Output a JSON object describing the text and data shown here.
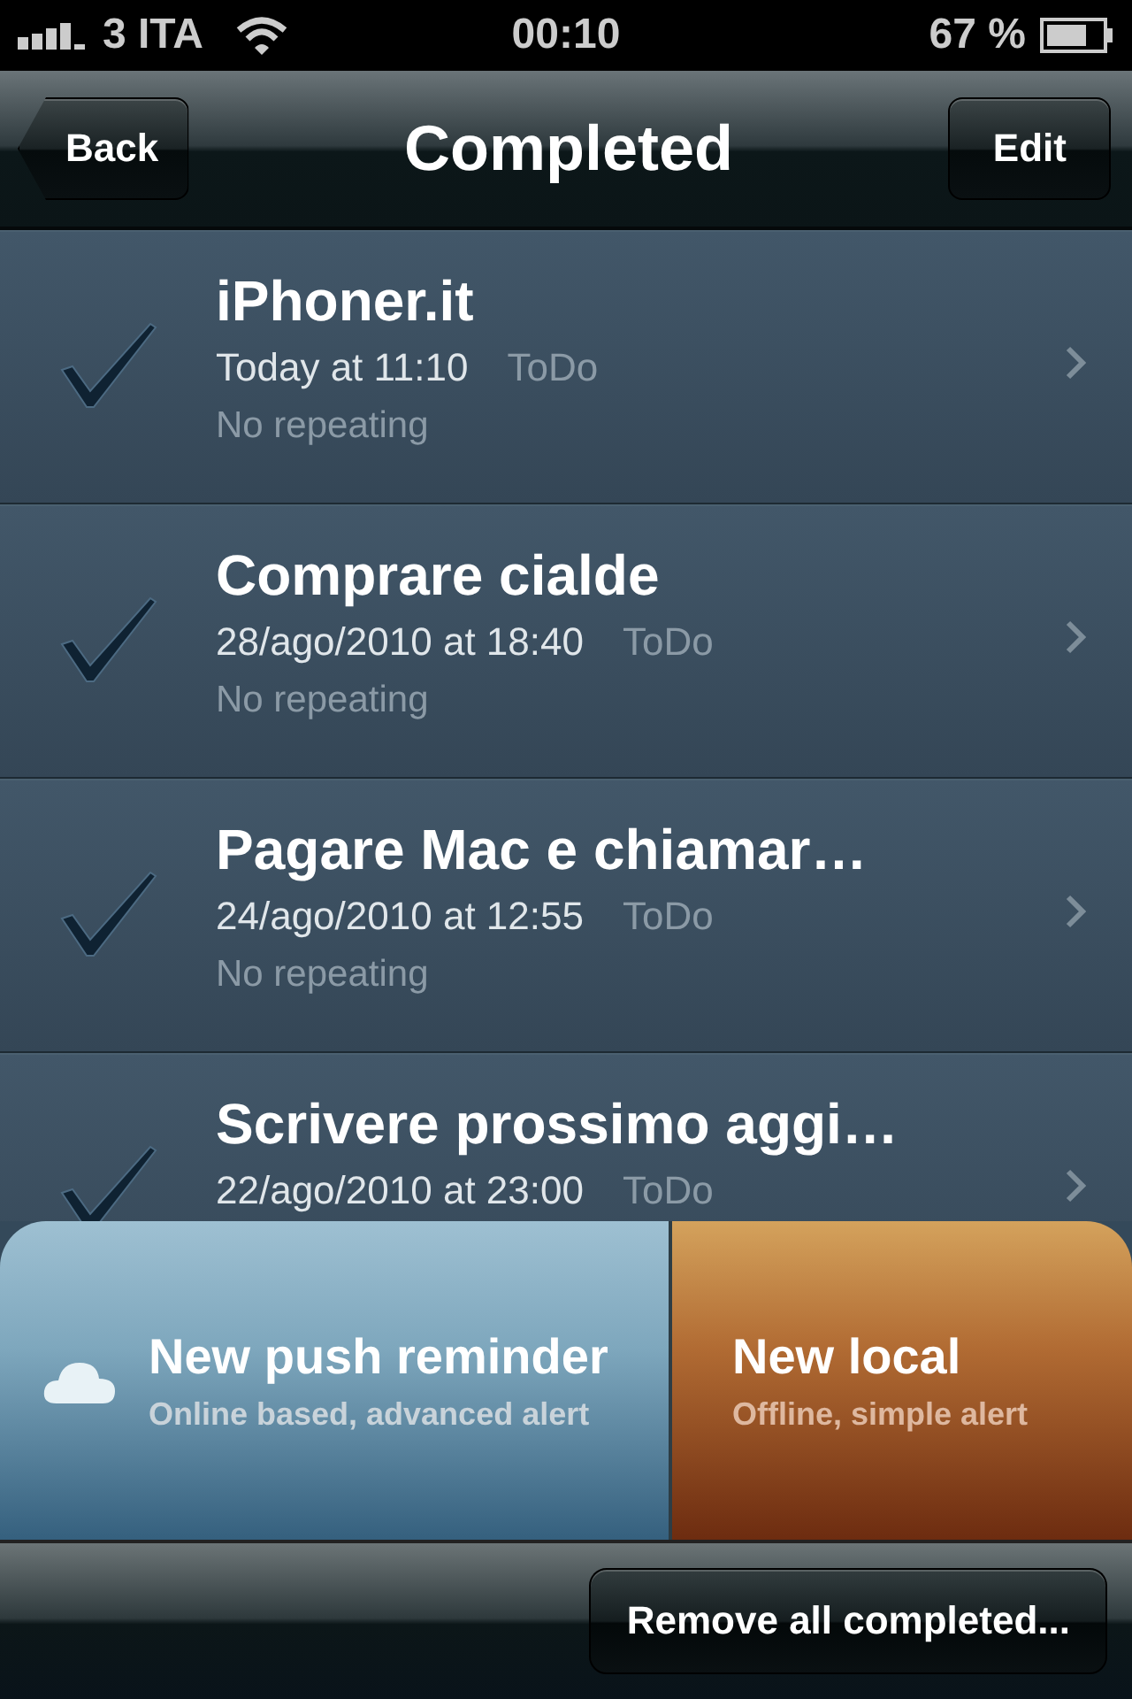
{
  "status_bar": {
    "carrier": "3 ITA",
    "time": "00:10",
    "battery": "67 %"
  },
  "nav": {
    "back": "Back",
    "title": "Completed",
    "edit": "Edit"
  },
  "items": [
    {
      "title": "iPhoner.it",
      "date": "Today at 11:10",
      "list": "ToDo",
      "repeat": "No repeating",
      "checked": true
    },
    {
      "title": "Comprare cialde",
      "date": "28/ago/2010 at 18:40",
      "list": "ToDo",
      "repeat": "No repeating",
      "checked": true
    },
    {
      "title": "Pagare Mac e chiamar…",
      "date": "24/ago/2010 at 12:55",
      "list": "ToDo",
      "repeat": "No repeating",
      "checked": true
    },
    {
      "title": "Scrivere prossimo aggi…",
      "date": "22/ago/2010 at 23:00",
      "list": "ToDo",
      "checked": true
    }
  ],
  "actions": [
    {
      "kind": "push",
      "title": "New push reminder",
      "subtitle": "Online based, advanced alert"
    },
    {
      "kind": "local",
      "title": "New local",
      "subtitle": "Offline, simple alert"
    }
  ],
  "toolbar": {
    "button": "Remove all completed..."
  }
}
